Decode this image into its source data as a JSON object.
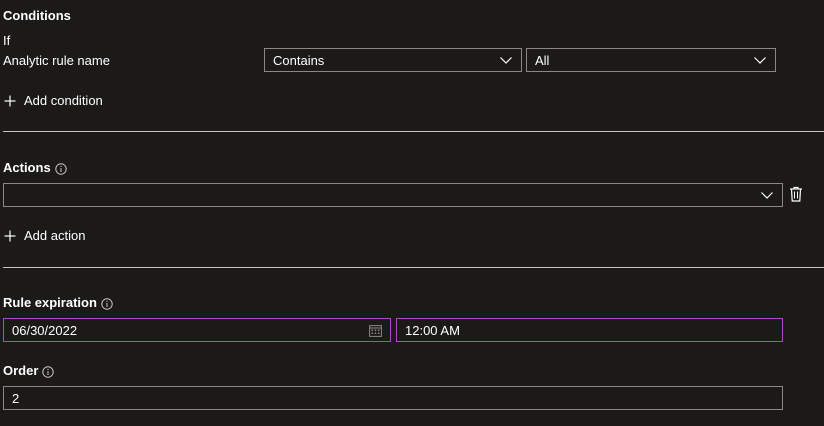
{
  "conditions": {
    "title": "Conditions",
    "if_label": "If",
    "field_label": "Analytic rule name",
    "operator_value": "Contains",
    "value_value": "All",
    "add_condition_label": "Add condition"
  },
  "actions": {
    "title": "Actions",
    "action_value": "",
    "add_action_label": "Add action"
  },
  "rule_expiration": {
    "title": "Rule expiration",
    "date_value": "06/30/2022",
    "time_value": "12:00 AM"
  },
  "order": {
    "title": "Order",
    "value": "2"
  },
  "colors": {
    "background": "#1b1a19",
    "border": "#8a8886",
    "focus_border": "#b146c2",
    "divider": "#c8c6c4",
    "text": "#ffffff"
  },
  "icons": {
    "info": "info-icon",
    "chevron": "chevron-down-icon",
    "plus": "plus-icon",
    "trash": "trash-icon",
    "calendar": "calendar-icon"
  }
}
